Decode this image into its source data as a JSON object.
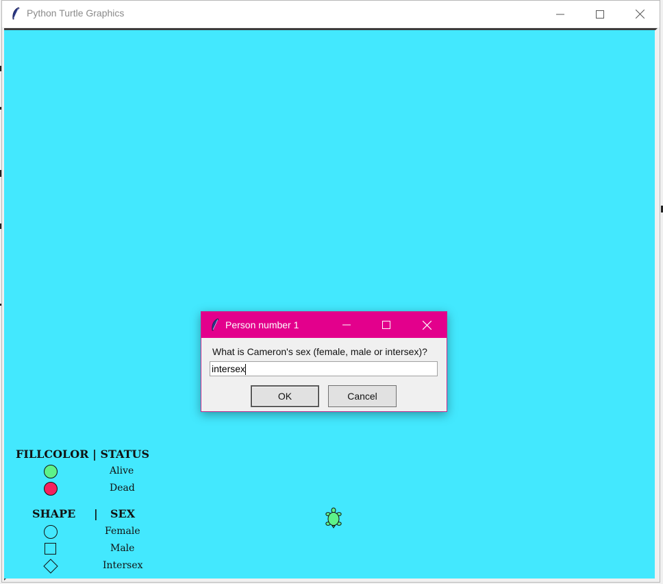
{
  "window": {
    "title": "Python Turtle Graphics",
    "canvas_color": "#43e8fe"
  },
  "legend": {
    "fillcolor_header": "FILLCOLOR | STATUS",
    "status_items": [
      {
        "label": "Alive",
        "color": "#5df28a"
      },
      {
        "label": "Dead",
        "color": "#f5215e"
      }
    ],
    "shape_header_left": "SHAPE",
    "shape_header_sep": "|",
    "shape_header_right": "SEX",
    "shape_items": [
      {
        "label": "Female",
        "shape": "circle"
      },
      {
        "label": "Male",
        "shape": "square"
      },
      {
        "label": "Intersex",
        "shape": "diamond"
      }
    ]
  },
  "turtle": {
    "color": "#5df28a",
    "icon": "turtle-icon"
  },
  "dialog": {
    "title": "Person number 1",
    "titlebar_color": "#e3008c",
    "prompt": "What is Cameron's sex (female, male or intersex)?",
    "input_value": "intersex",
    "ok_label": "OK",
    "cancel_label": "Cancel"
  }
}
